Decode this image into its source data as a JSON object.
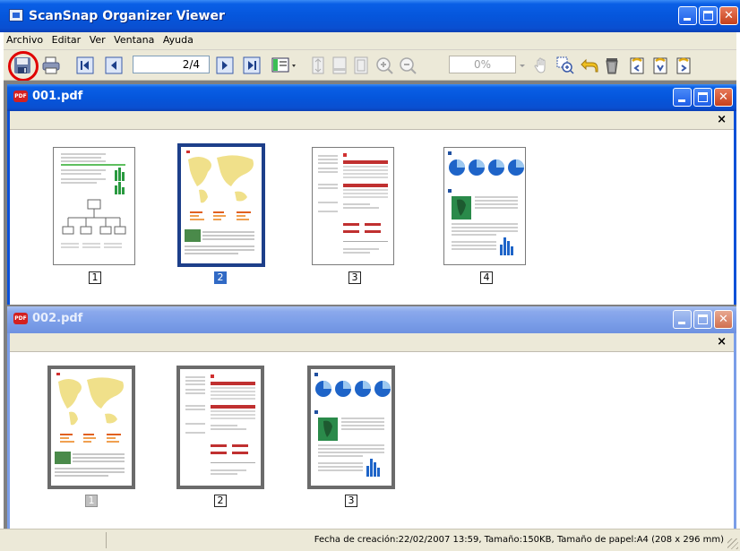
{
  "window": {
    "title": "ScanSnap Organizer Viewer"
  },
  "menu": [
    "Archivo",
    "Editar",
    "Ver",
    "Ventana",
    "Ayuda"
  ],
  "toolbar": {
    "page_indicator": "2/4",
    "zoom_value": "0%"
  },
  "documents": [
    {
      "title": "001.pdf",
      "state": "active",
      "pages": [
        "1",
        "2",
        "3",
        "4"
      ],
      "selected_page": "2"
    },
    {
      "title": "002.pdf",
      "state": "inactive",
      "pages": [
        "1",
        "2",
        "3"
      ],
      "selected_page": "1"
    }
  ],
  "strip_close": "×",
  "status": {
    "text": "Fecha de creación:22/02/2007 13:59, Tamaño:150KB, Tamaño de papel:A4 (208 x 296 mm)"
  },
  "colors": {
    "title_active": "#0556dc",
    "title_inactive": "#7b9ee8",
    "selection": "#316ac5",
    "highlight_circle": "#e00000"
  },
  "icons": {
    "save": "floppy-disk-icon",
    "print": "printer-icon",
    "first": "first-page-icon",
    "prev": "prev-page-icon",
    "next": "next-page-icon",
    "last": "last-page-icon"
  }
}
